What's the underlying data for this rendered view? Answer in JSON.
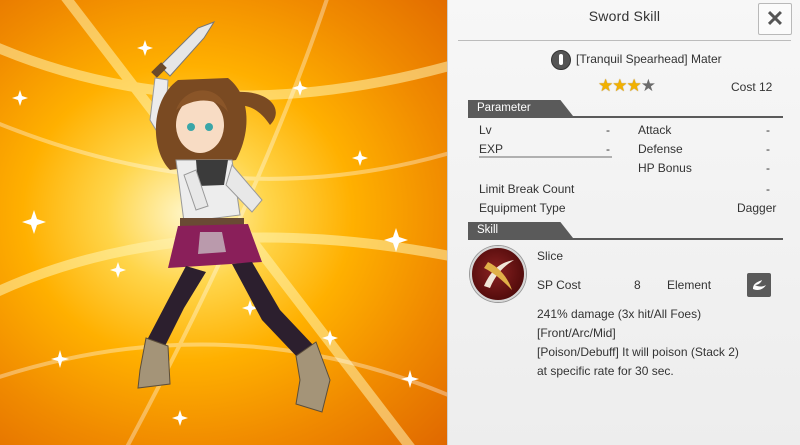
{
  "panel": {
    "title": "Sword Skill",
    "close_label": "✕"
  },
  "weapon": {
    "icon": "dagger-icon",
    "name": "[Tranquil Spearhead] Mater",
    "rarity_stars": 3,
    "rarity_max": 4,
    "cost_label": "Cost",
    "cost_value": "12"
  },
  "parameter": {
    "header": "Parameter",
    "lv_label": "Lv",
    "lv_value": "-",
    "exp_label": "EXP",
    "exp_value": "-",
    "attack_label": "Attack",
    "attack_value": "-",
    "defense_label": "Defense",
    "defense_value": "-",
    "hp_bonus_label": "HP Bonus",
    "hp_bonus_value": "-",
    "limit_break_label": "Limit Break Count",
    "limit_break_value": "-",
    "equipment_type_label": "Equipment Type",
    "equipment_type_value": "Dagger"
  },
  "skill": {
    "header": "Skill",
    "icon": "slash-skill-icon",
    "name": "Slice",
    "sp_cost_label": "SP Cost",
    "sp_cost_value": "8",
    "element_label": "Element",
    "element_icon": "wind-element-icon",
    "description_lines": [
      "241% damage (3x hit/All Foes)",
      "[Front/Arc/Mid]",
      "[Poison/Debuff] It will poison (Stack 2)",
      "at specific rate for 30 sec."
    ]
  },
  "colors": {
    "section_bar": "#5a5a5a",
    "star": "#f2b100",
    "art_orange": "#f08a00",
    "skill_icon_red": "#8a2222"
  }
}
